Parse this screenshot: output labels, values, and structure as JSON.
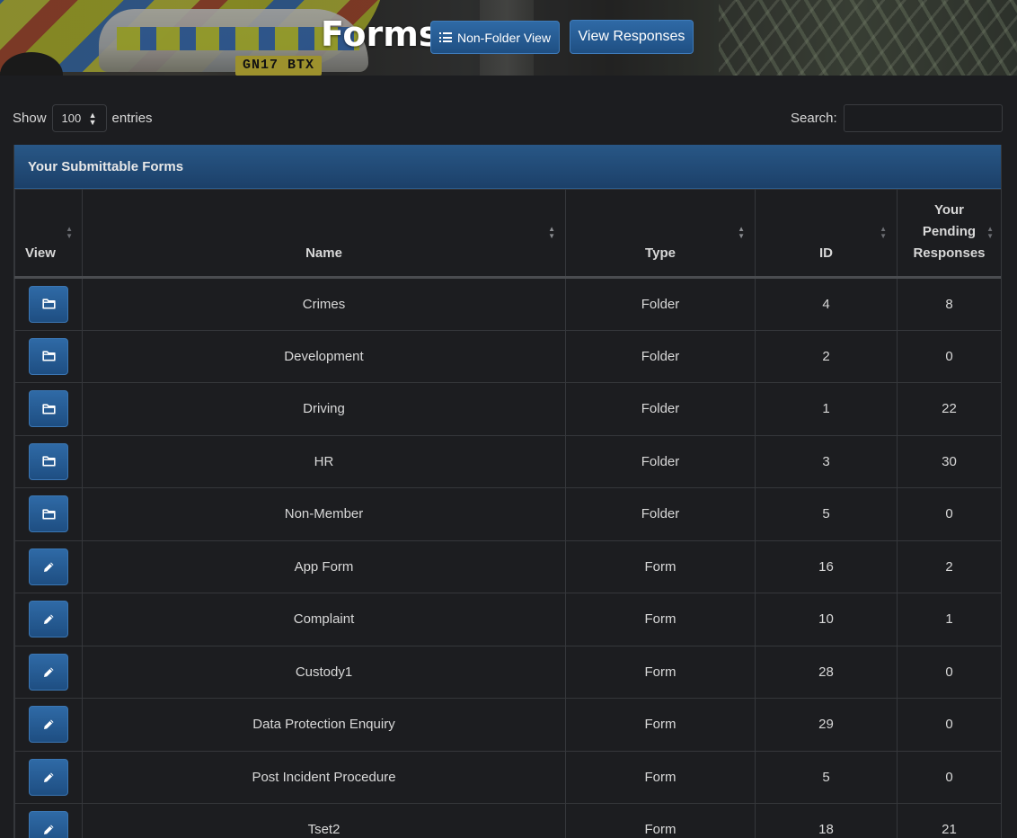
{
  "header": {
    "title": "Forms",
    "non_folder_label": "Non-Folder View",
    "responses_label": "View Responses",
    "plate_text": "GN17 BTX"
  },
  "controls": {
    "show_label": "Show",
    "entries_value": "100",
    "entries_label": "entries",
    "search_label": "Search:",
    "search_value": ""
  },
  "panel": {
    "title": "Your Submittable Forms"
  },
  "table": {
    "columns": {
      "view": "View",
      "name": "Name",
      "type": "Type",
      "id": "ID",
      "pending_1": "Your",
      "pending_2": "Pending",
      "pending_3": "Responses"
    },
    "rows": [
      {
        "icon": "folder-icon",
        "name": "Crimes",
        "type": "Folder",
        "id": "4",
        "pending": "8"
      },
      {
        "icon": "folder-icon",
        "name": "Development",
        "type": "Folder",
        "id": "2",
        "pending": "0"
      },
      {
        "icon": "folder-icon",
        "name": "Driving",
        "type": "Folder",
        "id": "1",
        "pending": "22"
      },
      {
        "icon": "folder-icon",
        "name": "HR",
        "type": "Folder",
        "id": "3",
        "pending": "30"
      },
      {
        "icon": "folder-icon",
        "name": "Non-Member",
        "type": "Folder",
        "id": "5",
        "pending": "0"
      },
      {
        "icon": "pencil-icon",
        "name": "App Form",
        "type": "Form",
        "id": "16",
        "pending": "2"
      },
      {
        "icon": "pencil-icon",
        "name": "Complaint",
        "type": "Form",
        "id": "10",
        "pending": "1"
      },
      {
        "icon": "pencil-icon",
        "name": "Custody1",
        "type": "Form",
        "id": "28",
        "pending": "0"
      },
      {
        "icon": "pencil-icon",
        "name": "Data Protection Enquiry",
        "type": "Form",
        "id": "29",
        "pending": "0"
      },
      {
        "icon": "pencil-icon",
        "name": "Post Incident Procedure",
        "type": "Form",
        "id": "5",
        "pending": "0"
      },
      {
        "icon": "pencil-icon",
        "name": "Tset2",
        "type": "Form",
        "id": "18",
        "pending": "21"
      }
    ]
  },
  "colors": {
    "accent": "#285786",
    "background": "#1c1d20",
    "button": "#2f6aa6"
  }
}
